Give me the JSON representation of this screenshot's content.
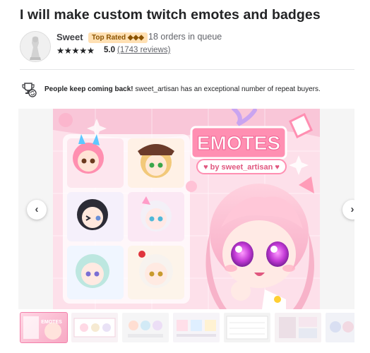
{
  "gig": {
    "title": "I will make custom twitch emotes and badges"
  },
  "seller": {
    "name": "Sweet",
    "level_badge": "Top Rated ◆◆◆",
    "queue": "18 orders in queue",
    "stars": "★★★★★",
    "rating": "5.0",
    "reviews": "(1743 reviews)"
  },
  "repeat_notice": {
    "icon": "trophy-repeat-icon",
    "headline": "People keep coming back!",
    "text": "sweet_artisan has an exceptional number of repeat buyers."
  },
  "gallery": {
    "banner_title": "EMOTES",
    "banner_byline": "♥ by sweet_artisan ♥",
    "prev_label": "‹",
    "next_label": "›",
    "thumbnail_count": 7,
    "active_thumbnail": 1
  },
  "colors": {
    "accent_pink": "#f37faa",
    "badge_bg": "#ffe0b3",
    "badge_text": "#8a5300"
  }
}
